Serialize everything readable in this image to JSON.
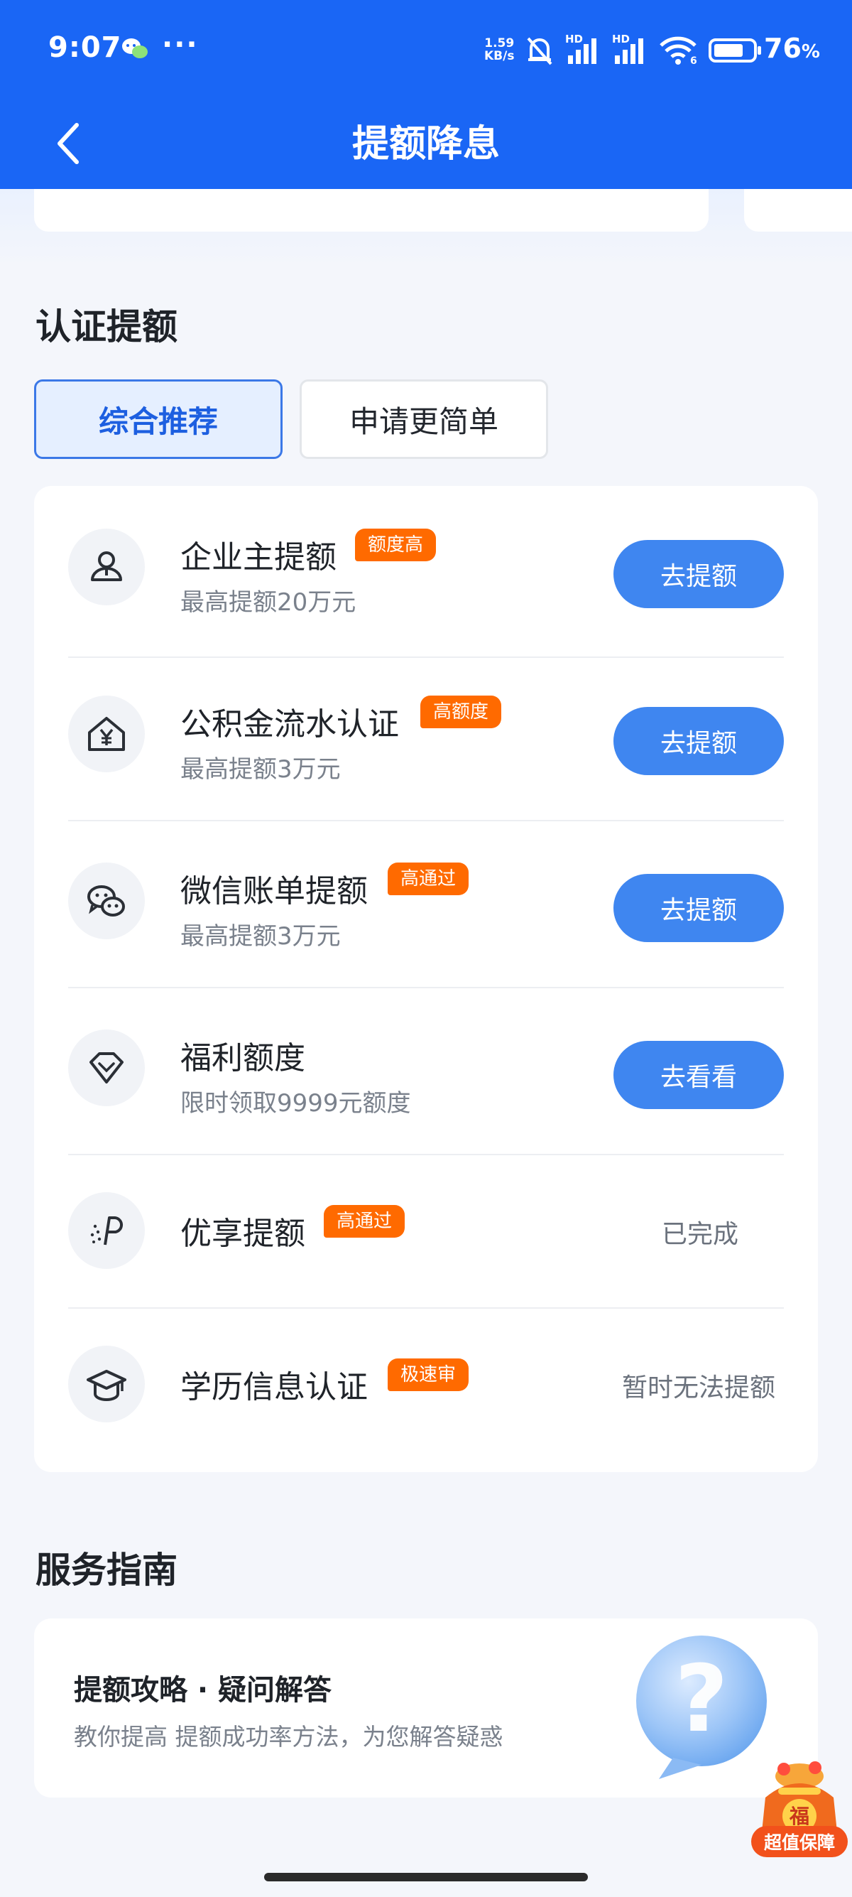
{
  "status_bar": {
    "time": "9:07",
    "net_speed_value": "1.59",
    "net_speed_unit": "KB/s",
    "battery": "76",
    "battery_unit": "%",
    "hd1": "HD",
    "hd2": "HD",
    "wifi_sub": "6"
  },
  "nav": {
    "title": "提额降息"
  },
  "section_verify": {
    "title": "认证提额"
  },
  "tabs": [
    {
      "label": "综合推荐",
      "active": true
    },
    {
      "label": "申请更简单",
      "active": false
    }
  ],
  "items": [
    {
      "title": "企业主提额",
      "badge": "额度高",
      "subtitle": "最高提额20万元",
      "action": "去提额",
      "icon": "person-icon"
    },
    {
      "title": "公积金流水认证",
      "badge": "高额度",
      "subtitle": "最高提额3万元",
      "action": "去提额",
      "icon": "house-yen-icon"
    },
    {
      "title": "微信账单提额",
      "badge": "高通过",
      "subtitle": "最高提额3万元",
      "action": "去提额",
      "icon": "wechat-icon"
    },
    {
      "title": "福利额度",
      "badge": "",
      "subtitle": "限时领取9999元额度",
      "action": "去看看",
      "icon": "diamond-icon"
    },
    {
      "title": "优享提额",
      "badge": "高通过",
      "subtitle": "",
      "status": "已完成",
      "icon": "speed-p-icon"
    },
    {
      "title": "学历信息认证",
      "badge": "极速审",
      "subtitle": "",
      "status": "暂时无法提额",
      "icon": "graduation-cap-icon"
    }
  ],
  "section_service": {
    "title": "服务指南"
  },
  "service_card": {
    "title": "提额攻略 · 疑问解答",
    "desc": "教你提高 提额成功率方法，为您解答疑惑",
    "icon": "question-bubble-icon"
  },
  "floating": {
    "label": "超值保障",
    "glyph": "福",
    "icon": "lucky-bag-icon"
  },
  "colors": {
    "primary": "#1a66f5",
    "button": "#3f86f0",
    "badge": "#ff6a00"
  }
}
